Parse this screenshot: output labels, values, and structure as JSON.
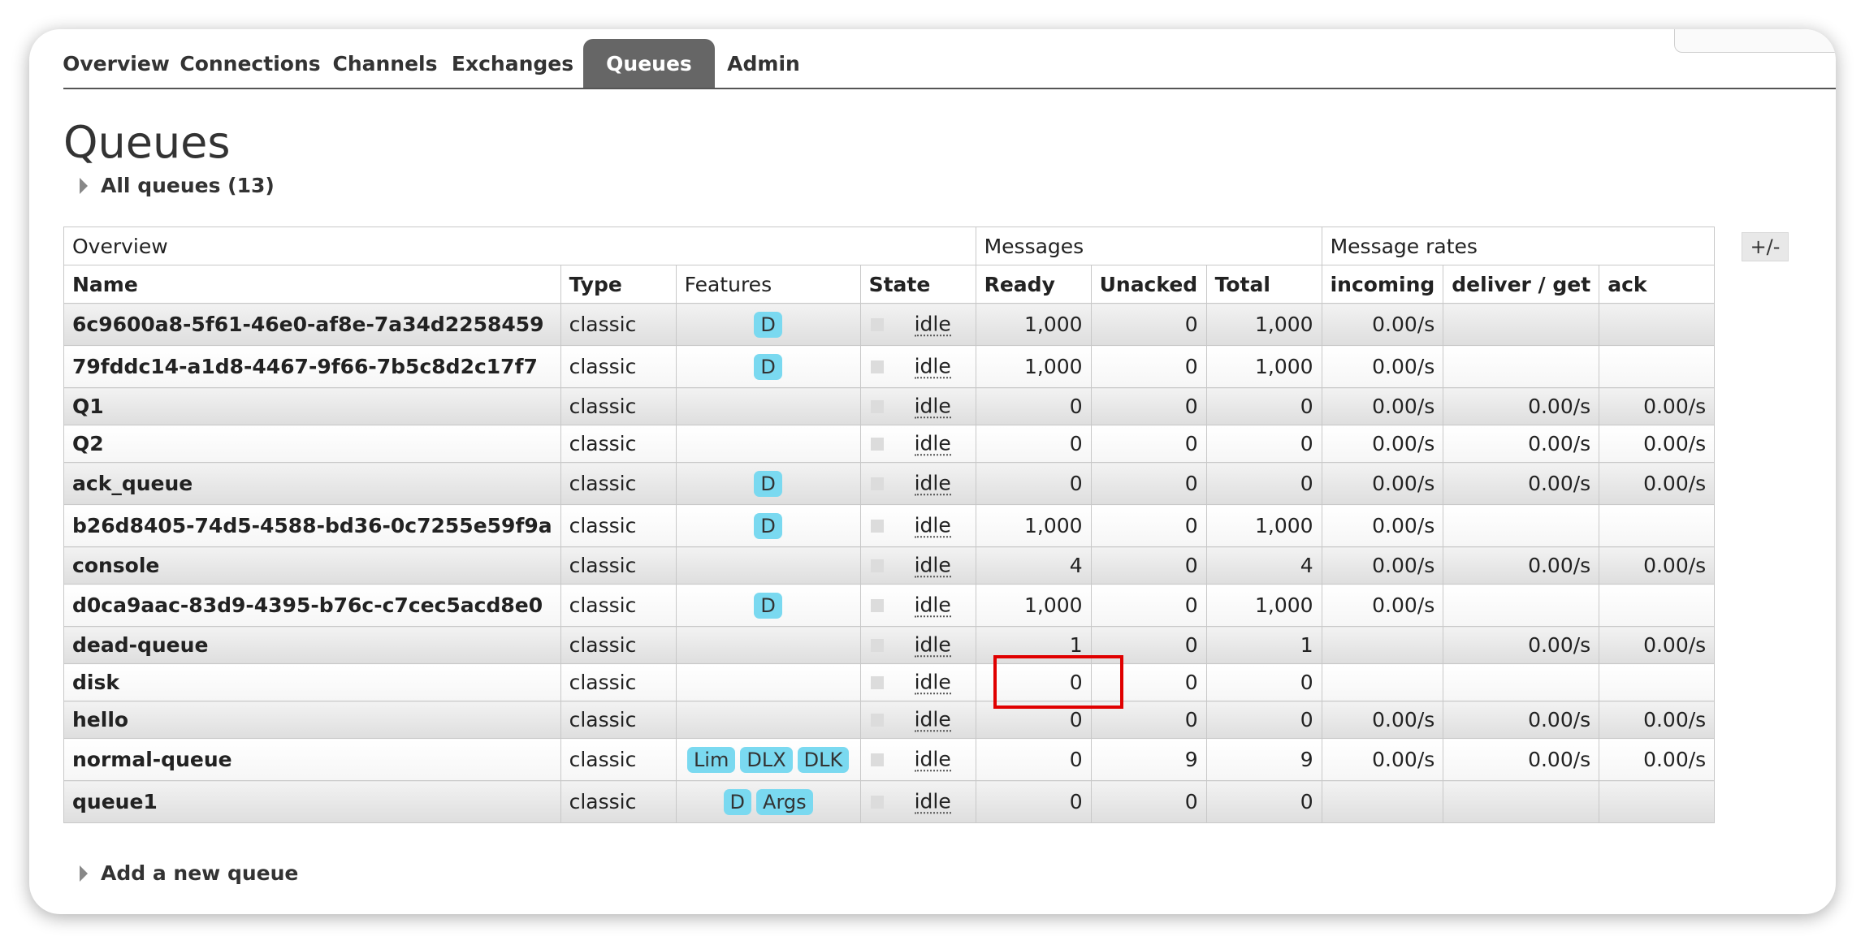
{
  "tabs": [
    {
      "label": "Overview"
    },
    {
      "label": "Connections"
    },
    {
      "label": "Channels"
    },
    {
      "label": "Exchanges"
    },
    {
      "label": "Queues",
      "active": true
    },
    {
      "label": "Admin"
    }
  ],
  "page_title": "Queues",
  "all_queues_label": "All queues (13)",
  "table": {
    "group_headers": {
      "overview": "Overview",
      "messages": "Messages",
      "rates": "Message rates"
    },
    "columns": {
      "name": "Name",
      "type": "Type",
      "features": "Features",
      "state": "State",
      "ready": "Ready",
      "unacked": "Unacked",
      "total": "Total",
      "incoming": "incoming",
      "deliver_get": "deliver / get",
      "ack": "ack"
    },
    "toggle_columns_label": "+/-",
    "rows": [
      {
        "name": "6c9600a8-5f61-46e0-af8e-7a34d2258459",
        "type": "classic",
        "features": [
          "D"
        ],
        "state": "idle",
        "ready": "1,000",
        "unacked": "0",
        "total": "1,000",
        "incoming": "0.00/s",
        "deliver_get": "",
        "ack": ""
      },
      {
        "name": "79fddc14-a1d8-4467-9f66-7b5c8d2c17f7",
        "type": "classic",
        "features": [
          "D"
        ],
        "state": "idle",
        "ready": "1,000",
        "unacked": "0",
        "total": "1,000",
        "incoming": "0.00/s",
        "deliver_get": "",
        "ack": ""
      },
      {
        "name": "Q1",
        "type": "classic",
        "features": [],
        "state": "idle",
        "ready": "0",
        "unacked": "0",
        "total": "0",
        "incoming": "0.00/s",
        "deliver_get": "0.00/s",
        "ack": "0.00/s"
      },
      {
        "name": "Q2",
        "type": "classic",
        "features": [],
        "state": "idle",
        "ready": "0",
        "unacked": "0",
        "total": "0",
        "incoming": "0.00/s",
        "deliver_get": "0.00/s",
        "ack": "0.00/s"
      },
      {
        "name": "ack_queue",
        "type": "classic",
        "features": [
          "D"
        ],
        "state": "idle",
        "ready": "0",
        "unacked": "0",
        "total": "0",
        "incoming": "0.00/s",
        "deliver_get": "0.00/s",
        "ack": "0.00/s"
      },
      {
        "name": "b26d8405-74d5-4588-bd36-0c7255e59f9a",
        "type": "classic",
        "features": [
          "D"
        ],
        "state": "idle",
        "ready": "1,000",
        "unacked": "0",
        "total": "1,000",
        "incoming": "0.00/s",
        "deliver_get": "",
        "ack": ""
      },
      {
        "name": "console",
        "type": "classic",
        "features": [],
        "state": "idle",
        "ready": "4",
        "unacked": "0",
        "total": "4",
        "incoming": "0.00/s",
        "deliver_get": "0.00/s",
        "ack": "0.00/s"
      },
      {
        "name": "d0ca9aac-83d9-4395-b76c-c7cec5acd8e0",
        "type": "classic",
        "features": [
          "D"
        ],
        "state": "idle",
        "ready": "1,000",
        "unacked": "0",
        "total": "1,000",
        "incoming": "0.00/s",
        "deliver_get": "",
        "ack": ""
      },
      {
        "name": "dead-queue",
        "type": "classic",
        "features": [],
        "state": "idle",
        "ready": "1",
        "unacked": "0",
        "total": "1",
        "incoming": "",
        "deliver_get": "0.00/s",
        "ack": "0.00/s"
      },
      {
        "name": "disk",
        "type": "classic",
        "features": [],
        "state": "idle",
        "ready": "0",
        "unacked": "0",
        "total": "0",
        "incoming": "",
        "deliver_get": "",
        "ack": ""
      },
      {
        "name": "hello",
        "type": "classic",
        "features": [],
        "state": "idle",
        "ready": "0",
        "unacked": "0",
        "total": "0",
        "incoming": "0.00/s",
        "deliver_get": "0.00/s",
        "ack": "0.00/s"
      },
      {
        "name": "normal-queue",
        "type": "classic",
        "features": [
          "Lim",
          "DLX",
          "DLK"
        ],
        "state": "idle",
        "ready": "0",
        "unacked": "9",
        "total": "9",
        "incoming": "0.00/s",
        "deliver_get": "0.00/s",
        "ack": "0.00/s"
      },
      {
        "name": "queue1",
        "type": "classic",
        "features": [
          "D",
          "Args"
        ],
        "state": "idle",
        "ready": "0",
        "unacked": "0",
        "total": "0",
        "incoming": "",
        "deliver_get": "",
        "ack": ""
      }
    ]
  },
  "add_queue_label": "Add a new queue",
  "colors": {
    "active_tab_bg": "#666666",
    "feature_badge": "#7ad9f0",
    "highlight_box": "#e00000"
  }
}
